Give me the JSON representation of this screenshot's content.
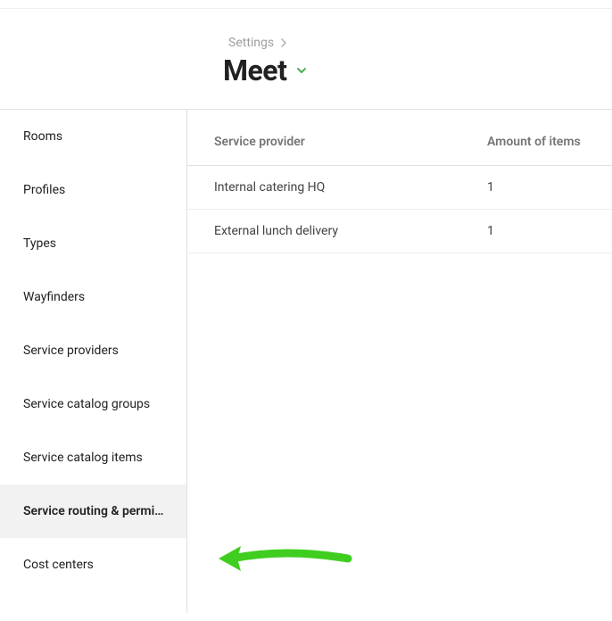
{
  "breadcrumb": {
    "parent": "Settings"
  },
  "page": {
    "title": "Meet"
  },
  "sidebar": {
    "items": [
      "Rooms",
      "Profiles",
      "Types",
      "Wayfinders",
      "Service providers",
      "Service catalog groups",
      "Service catalog items",
      "Service routing & permissi…",
      "Cost centers"
    ],
    "activeIndex": 7
  },
  "table": {
    "headers": {
      "provider": "Service provider",
      "amount": "Amount of items"
    },
    "rows": [
      {
        "provider": "Internal catering HQ",
        "amount": "1"
      },
      {
        "provider": "External lunch delivery",
        "amount": "1"
      }
    ]
  },
  "annotation": {
    "color": "#3fce1f"
  }
}
